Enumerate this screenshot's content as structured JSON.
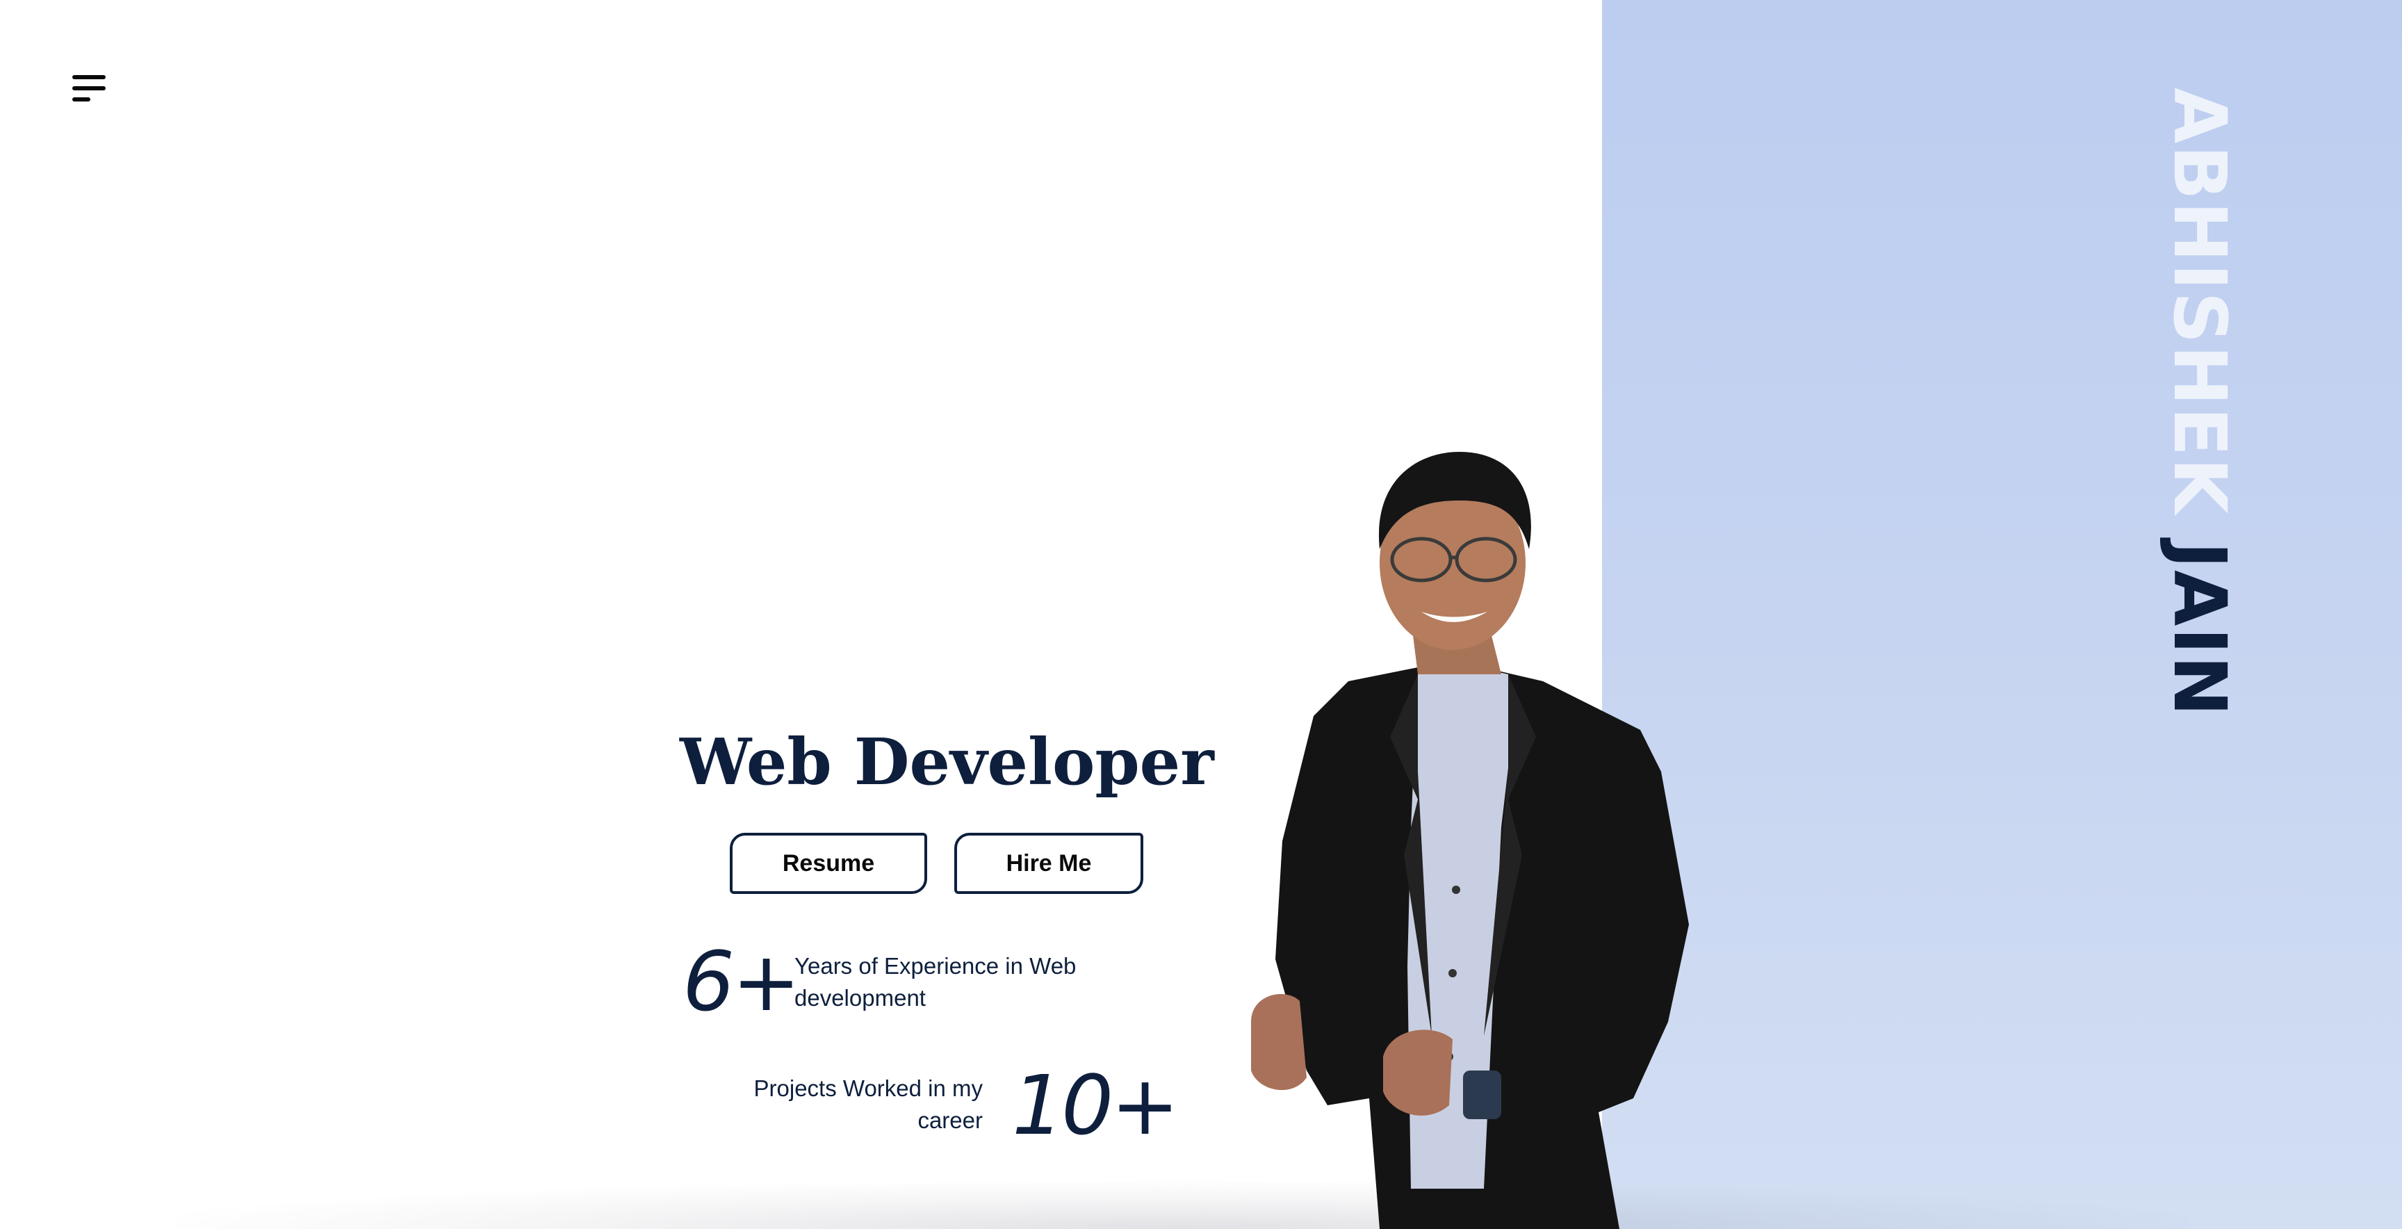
{
  "header": {
    "menu_icon": "hamburger-menu-icon"
  },
  "hero": {
    "title": "Web Developer",
    "name_first": "ABHISHEK",
    "name_last": "JAIN",
    "buttons": {
      "resume": "Resume",
      "hire": "Hire Me"
    },
    "stats": {
      "experience_value": "6+",
      "experience_label": "Years of Experience in Web development",
      "projects_value": "10+",
      "projects_label": "Projects Worked in my career"
    }
  },
  "colors": {
    "panel": "#bccdf0",
    "ink": "#0e1f3d",
    "name_light": "#eef3fb"
  }
}
